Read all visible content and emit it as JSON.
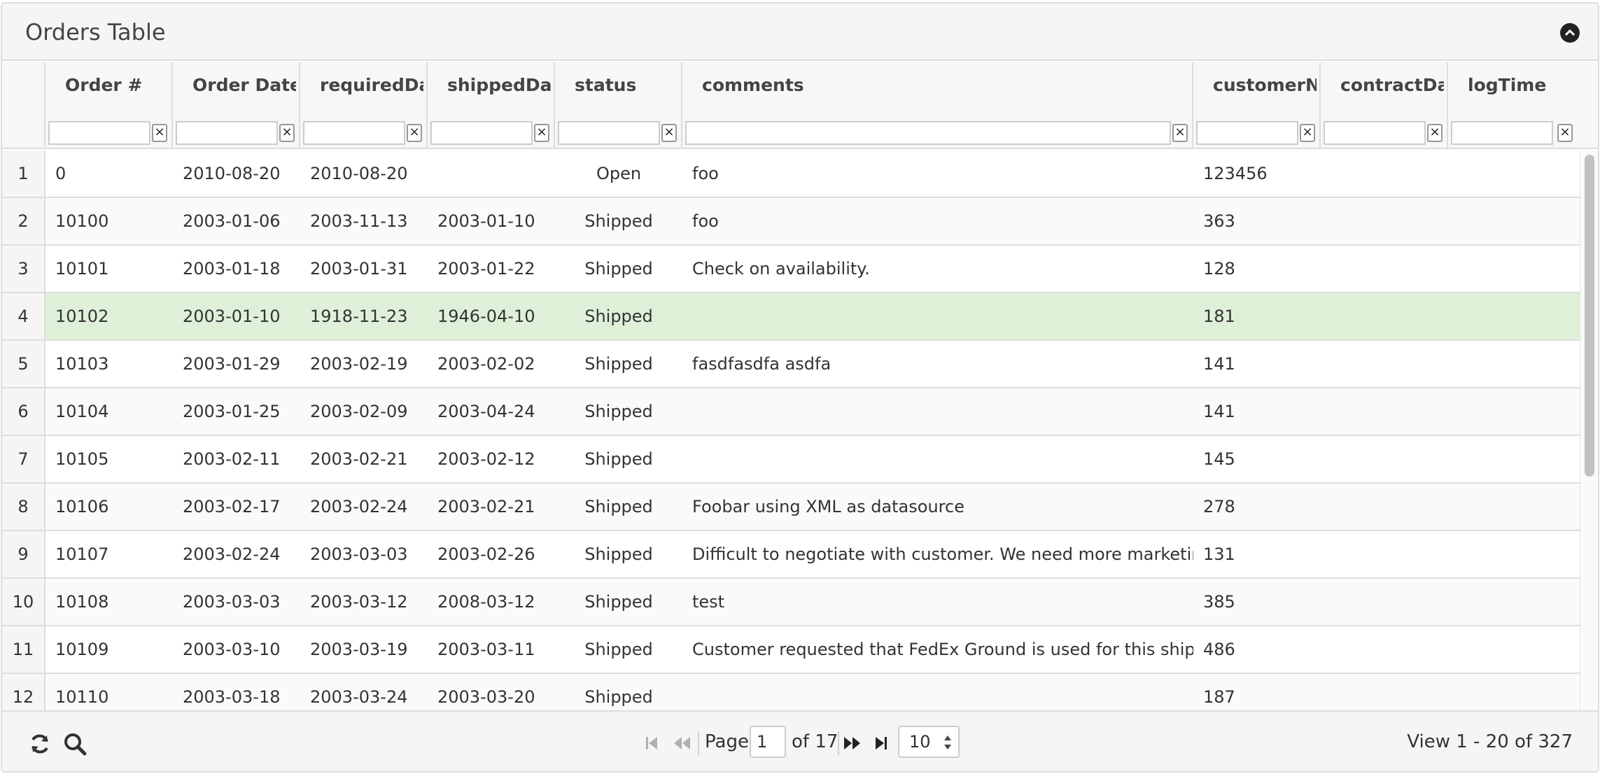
{
  "caption": {
    "title": "Orders Table"
  },
  "columns": [
    {
      "label": "Order #"
    },
    {
      "label": "Order Date"
    },
    {
      "label": "requiredDate"
    },
    {
      "label": "shippedDate"
    },
    {
      "label": "status"
    },
    {
      "label": "comments"
    },
    {
      "label": "customerNumber"
    },
    {
      "label": "contractDate"
    },
    {
      "label": "logTime"
    }
  ],
  "filter_clear_symbol": "×",
  "rows": [
    {
      "n": "1",
      "order": "0",
      "orderDate": "2010-08-20",
      "required": "2010-08-20",
      "shipped": "",
      "status": "Open",
      "comments": "foo",
      "customer": "123456"
    },
    {
      "n": "2",
      "order": "10100",
      "orderDate": "2003-01-06",
      "required": "2003-11-13",
      "shipped": "2003-01-10",
      "status": "Shipped",
      "comments": "foo",
      "customer": "363"
    },
    {
      "n": "3",
      "order": "10101",
      "orderDate": "2003-01-18",
      "required": "2003-01-31",
      "shipped": "2003-01-22",
      "status": "Shipped",
      "comments": "Check on availability.",
      "customer": "128"
    },
    {
      "n": "4",
      "order": "10102",
      "orderDate": "2003-01-10",
      "required": "1918-11-23",
      "shipped": "1946-04-10",
      "status": "Shipped",
      "comments": "",
      "customer": "181"
    },
    {
      "n": "5",
      "order": "10103",
      "orderDate": "2003-01-29",
      "required": "2003-02-19",
      "shipped": "2003-02-02",
      "status": "Shipped",
      "comments": "fasdfasdfa asdfa",
      "customer": "141"
    },
    {
      "n": "6",
      "order": "10104",
      "orderDate": "2003-01-25",
      "required": "2003-02-09",
      "shipped": "2003-04-24",
      "status": "Shipped",
      "comments": "",
      "customer": "141"
    },
    {
      "n": "7",
      "order": "10105",
      "orderDate": "2003-02-11",
      "required": "2003-02-21",
      "shipped": "2003-02-12",
      "status": "Shipped",
      "comments": "",
      "customer": "145"
    },
    {
      "n": "8",
      "order": "10106",
      "orderDate": "2003-02-17",
      "required": "2003-02-24",
      "shipped": "2003-02-21",
      "status": "Shipped",
      "comments": "Foobar using XML as datasource",
      "customer": "278"
    },
    {
      "n": "9",
      "order": "10107",
      "orderDate": "2003-02-24",
      "required": "2003-03-03",
      "shipped": "2003-02-26",
      "status": "Shipped",
      "comments": "Difficult to negotiate with customer. We need more marketing m",
      "customer": "131"
    },
    {
      "n": "10",
      "order": "10108",
      "orderDate": "2003-03-03",
      "required": "2003-03-12",
      "shipped": "2008-03-12",
      "status": "Shipped",
      "comments": "test",
      "customer": "385"
    },
    {
      "n": "11",
      "order": "10109",
      "orderDate": "2003-03-10",
      "required": "2003-03-19",
      "shipped": "2003-03-11",
      "status": "Shipped",
      "comments": "Customer requested that FedEx Ground is used for this shipping",
      "customer": "486"
    },
    {
      "n": "12",
      "order": "10110",
      "orderDate": "2003-03-18",
      "required": "2003-03-24",
      "shipped": "2003-03-20",
      "status": "Shipped",
      "comments": "",
      "customer": "187"
    }
  ],
  "selected_row": "4",
  "pager": {
    "page_label": "Page",
    "page_value": "1",
    "of_label": "of 17",
    "rows_per_page": "10",
    "view_info": "View 1 - 20 of 327"
  },
  "icons": {
    "collapse": "circle-chevron-up-icon",
    "refresh": "refresh-icon",
    "search": "search-icon",
    "first": "first-page-icon",
    "prev": "prev-page-icon",
    "next": "next-page-icon",
    "last": "last-page-icon"
  },
  "colors": {
    "selected_row": "#dff0d8",
    "header_bg": "#f7f7f7",
    "border": "#dddddd"
  }
}
